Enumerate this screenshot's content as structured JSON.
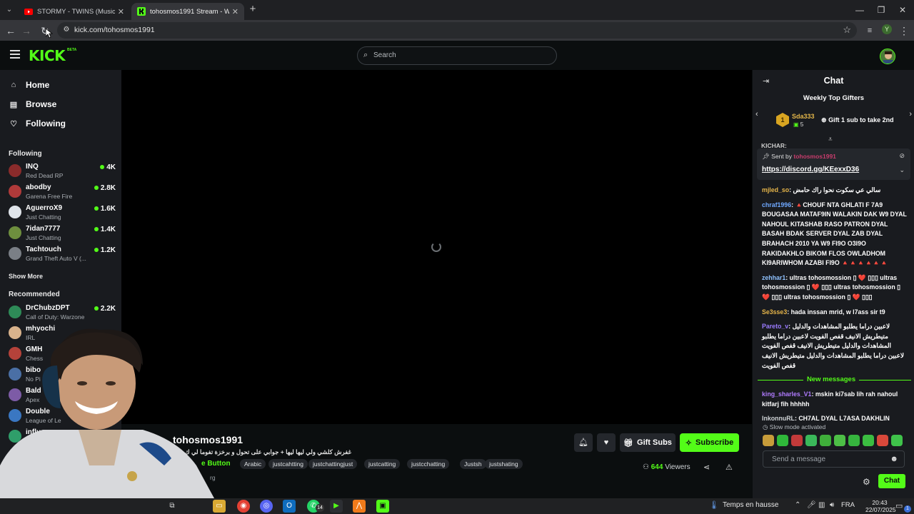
{
  "browser": {
    "tabs": [
      {
        "title": "STORMY - TWINS (Music Video)",
        "favicon": "youtube-icon",
        "active": false
      },
      {
        "title": "tohosmos1991 Stream - Watch",
        "favicon": "kick-icon",
        "active": true
      }
    ],
    "url": "kick.com/tohosmos1991",
    "profile_initial": "Y"
  },
  "header": {
    "logo": "KICK",
    "logo_badge": "BETA",
    "search_placeholder": "Search"
  },
  "sidebar": {
    "nav": [
      {
        "label": "Home",
        "icon": "home-icon"
      },
      {
        "label": "Browse",
        "icon": "browse-icon"
      },
      {
        "label": "Following",
        "icon": "heart-icon"
      }
    ],
    "following_title": "Following",
    "following": [
      {
        "name": "INQ",
        "category": "Red Dead RP",
        "viewers": "4K",
        "color": "#8a2b2b"
      },
      {
        "name": "abodby",
        "category": "Garena Free Fire",
        "viewers": "2.8K",
        "color": "#b03a3a"
      },
      {
        "name": "AguerroX9",
        "category": "Just Chatting",
        "viewers": "1.6K",
        "color": "#dfe4ea"
      },
      {
        "name": "7idan7777",
        "category": "Just Chatting",
        "viewers": "1.4K",
        "color": "#6e8f3e"
      },
      {
        "name": "Tachtouch",
        "category": "Grand Theft Auto V (...",
        "viewers": "1.2K",
        "color": "#7a7f86"
      }
    ],
    "show_more": "Show More",
    "recommended_title": "Recommended",
    "recommended": [
      {
        "name": "DrChubzDPT",
        "category": "Call of Duty: Warzone",
        "viewers": "2.2K",
        "color": "#2e8b57"
      },
      {
        "name": "mhyochi",
        "category": "IRL",
        "viewers": "",
        "color": "#d9b38c"
      },
      {
        "name": "GMH",
        "category": "Chess",
        "viewers": "",
        "color": "#b5423a"
      },
      {
        "name": "bibo",
        "category": "No Pi",
        "viewers": "",
        "color": "#4a6fa5"
      },
      {
        "name": "Bald",
        "category": "Apex",
        "viewers": "",
        "color": "#7d5ba6"
      },
      {
        "name": "Double",
        "category": "League of Le",
        "viewers": "",
        "color": "#3a77c2"
      },
      {
        "name": "influenc",
        "category": "IRL",
        "viewers": "",
        "color": "#2f9e6a"
      }
    ]
  },
  "stream": {
    "streamer": "tohosmos1991",
    "title": "غفرش كلشي ولي ليها ليها + جوابي على تحول و برخزة تفوما لي ك",
    "category_link": "e Button",
    "tags": [
      "Arabic",
      "justcahtting",
      "justchattingjust",
      "justcatting",
      "justcchatting",
      "Justsh",
      "justshating"
    ],
    "extra_tag": "rg",
    "gift_subs": "Gift Subs",
    "subscribe": "Subscribe",
    "viewers_count": "644",
    "viewers_label": "Viewers"
  },
  "chat": {
    "title": "Chat",
    "gifters_title": "Weekly Top Gifters",
    "top_gifter": {
      "rank": "1",
      "name": "Sda333",
      "count": "5"
    },
    "gifter_cta": "Gift 1 sub to take 2nd",
    "pinned_ghost": "KICHAR:",
    "pinned": {
      "sent_by_label": "Sent by",
      "sender": "tohosmos1991",
      "link": "https://discord.gg/KEexxD36"
    },
    "messages": [
      {
        "user": "mjled_so",
        "color": "#e6b54a",
        "text": "سالي عي سكوت نحوا راك حامض",
        "rtl": true
      },
      {
        "user": "chraf1996",
        "color": "#6fa8ff",
        "text": "🔺CHOUF NTA GHLATI F 7A9 BOUGASAA MATAF9IN WALAKIN DAK W9 DYAL NAHOUL KITASHAB RASO PATRON DYAL BASAH BDAK SERVER DYAL ZAB DYAL BRAHACH 2010 YA W9 FI9O O3I9O RAKIDAKHLO BIKOM FLOS OWLADHOM KI9ARIWHOM AZABI FI9O 🔺🔺🔺🔺🔺🔺",
        "rtl": false
      },
      {
        "user": "zehhar1",
        "color": "#8fc2ff",
        "text": "ultras tohosmossion ▯ ❤️ ▯▯▯ ultras tohosmossion ▯ ❤️ ▯▯▯ ultras tohosmossion ▯ ❤️ ▯▯▯ ultras tohosmossion ▯ ❤️ ▯▯▯",
        "rtl": false
      },
      {
        "user": "Se3sse3",
        "color": "#e6b54a",
        "text": "hada inssan mrid, w l7ass sir t9",
        "rtl": false
      },
      {
        "user": "Pareto_v",
        "color": "#9b7bff",
        "text": "لاعبين دراما يطلبو المشاهدات والدليل متيطريش الانيف قفص الفويت لاعبين دراما يطلبو المشاهدات والدليل متيطريش الانيف قفص الفويت لاعبين دراما يطلبو المشاهدات والدليل متيطريش الانيف قفص الفويت",
        "rtl": true
      }
    ],
    "new_messages_label": "New messages",
    "new_messages": [
      {
        "user": "king_sharles_V1",
        "color": "#b07bff",
        "text": "mskin ki7sab lih rah nahoul kitfarj fih hhhhh",
        "rtl": false
      },
      {
        "user": "InkonnuRL",
        "color": "#cfd3d6",
        "text": "CH7AL DYAL L7ASA DAKHLIN",
        "rtl": false
      }
    ],
    "slow_mode": "Slow mode activated",
    "input_placeholder": "Send a message",
    "send_label": "Chat"
  },
  "taskbar": {
    "weather": "Temps en hausse",
    "lang": "FRA",
    "time": "20:43",
    "date": "22/07/2025",
    "whatsapp_badge": "14",
    "notif_count": "1"
  }
}
